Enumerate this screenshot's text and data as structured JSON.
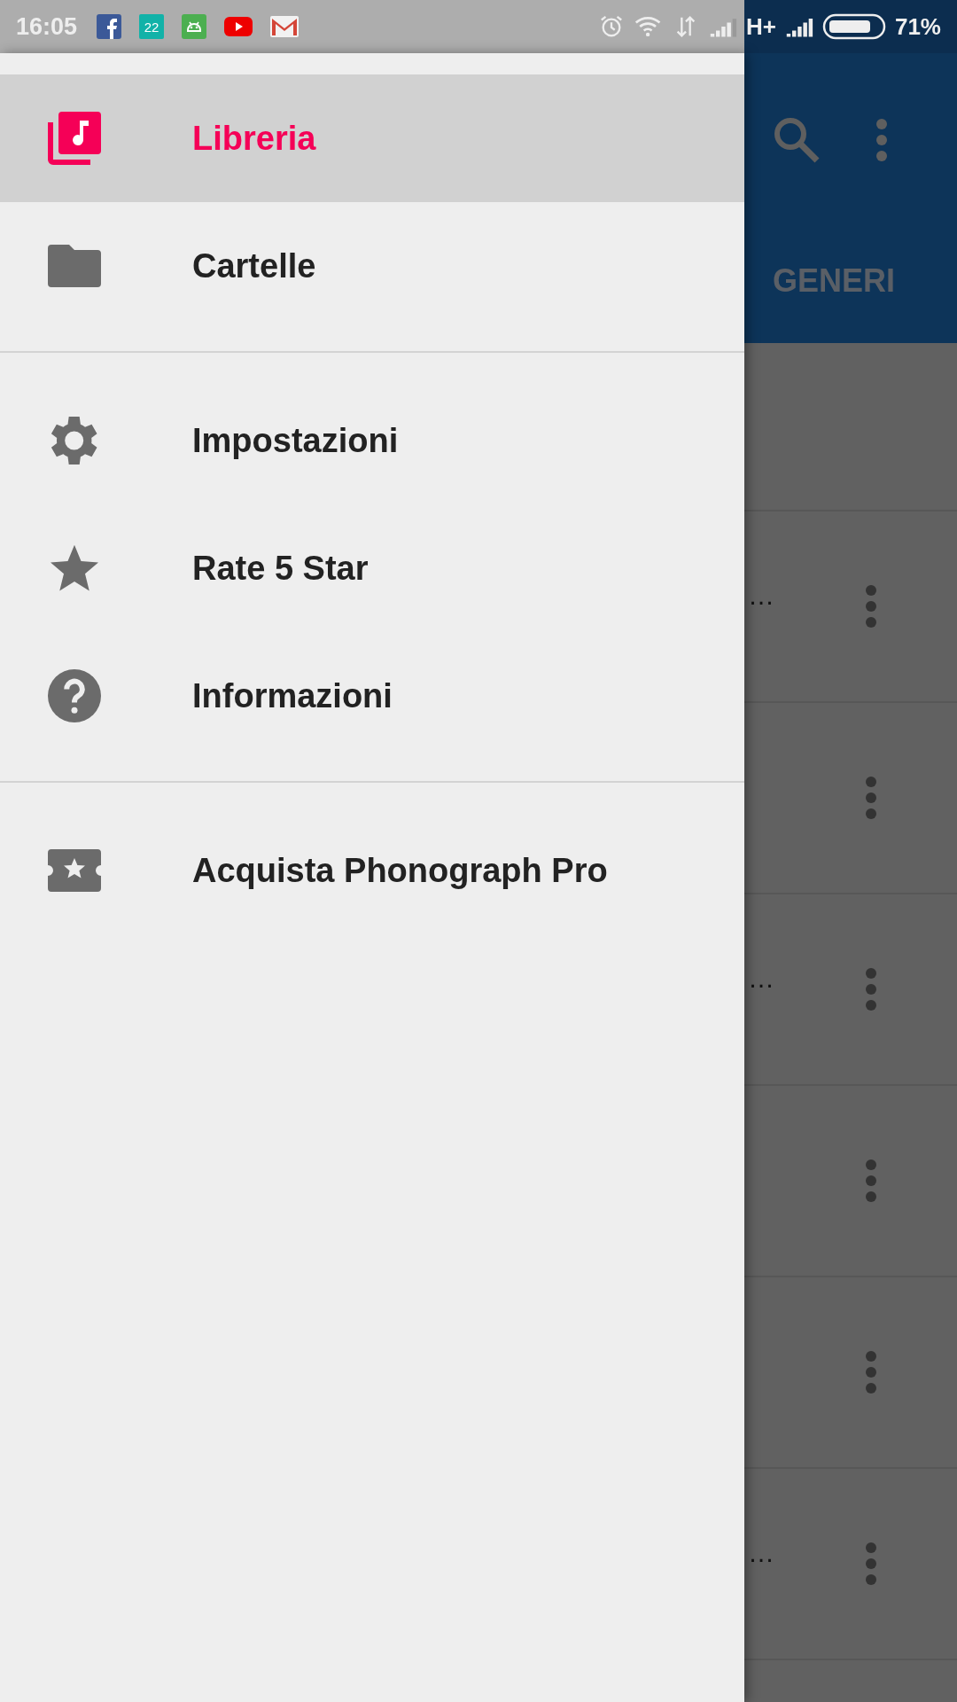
{
  "status_bar": {
    "time": "16:05",
    "calendar_date": "22",
    "network": "H+",
    "battery": "71%"
  },
  "drawer": {
    "groups": [
      [
        {
          "label": "Libreria",
          "kind": "library",
          "selected": true
        },
        {
          "label": "Cartelle",
          "kind": "folder",
          "selected": false
        }
      ],
      [
        {
          "label": "Impostazioni",
          "kind": "settings",
          "selected": false
        },
        {
          "label": "Rate 5 Star",
          "kind": "star",
          "selected": false
        },
        {
          "label": "Informazioni",
          "kind": "help",
          "selected": false
        }
      ],
      [
        {
          "label": "Acquista Phonograph Pro",
          "kind": "ticket",
          "selected": false
        }
      ]
    ]
  },
  "main": {
    "tab": "GENERI",
    "rows": [
      {
        "title": "…"
      },
      {},
      {
        "title": "…"
      },
      {},
      {},
      {
        "title": "…"
      }
    ]
  }
}
